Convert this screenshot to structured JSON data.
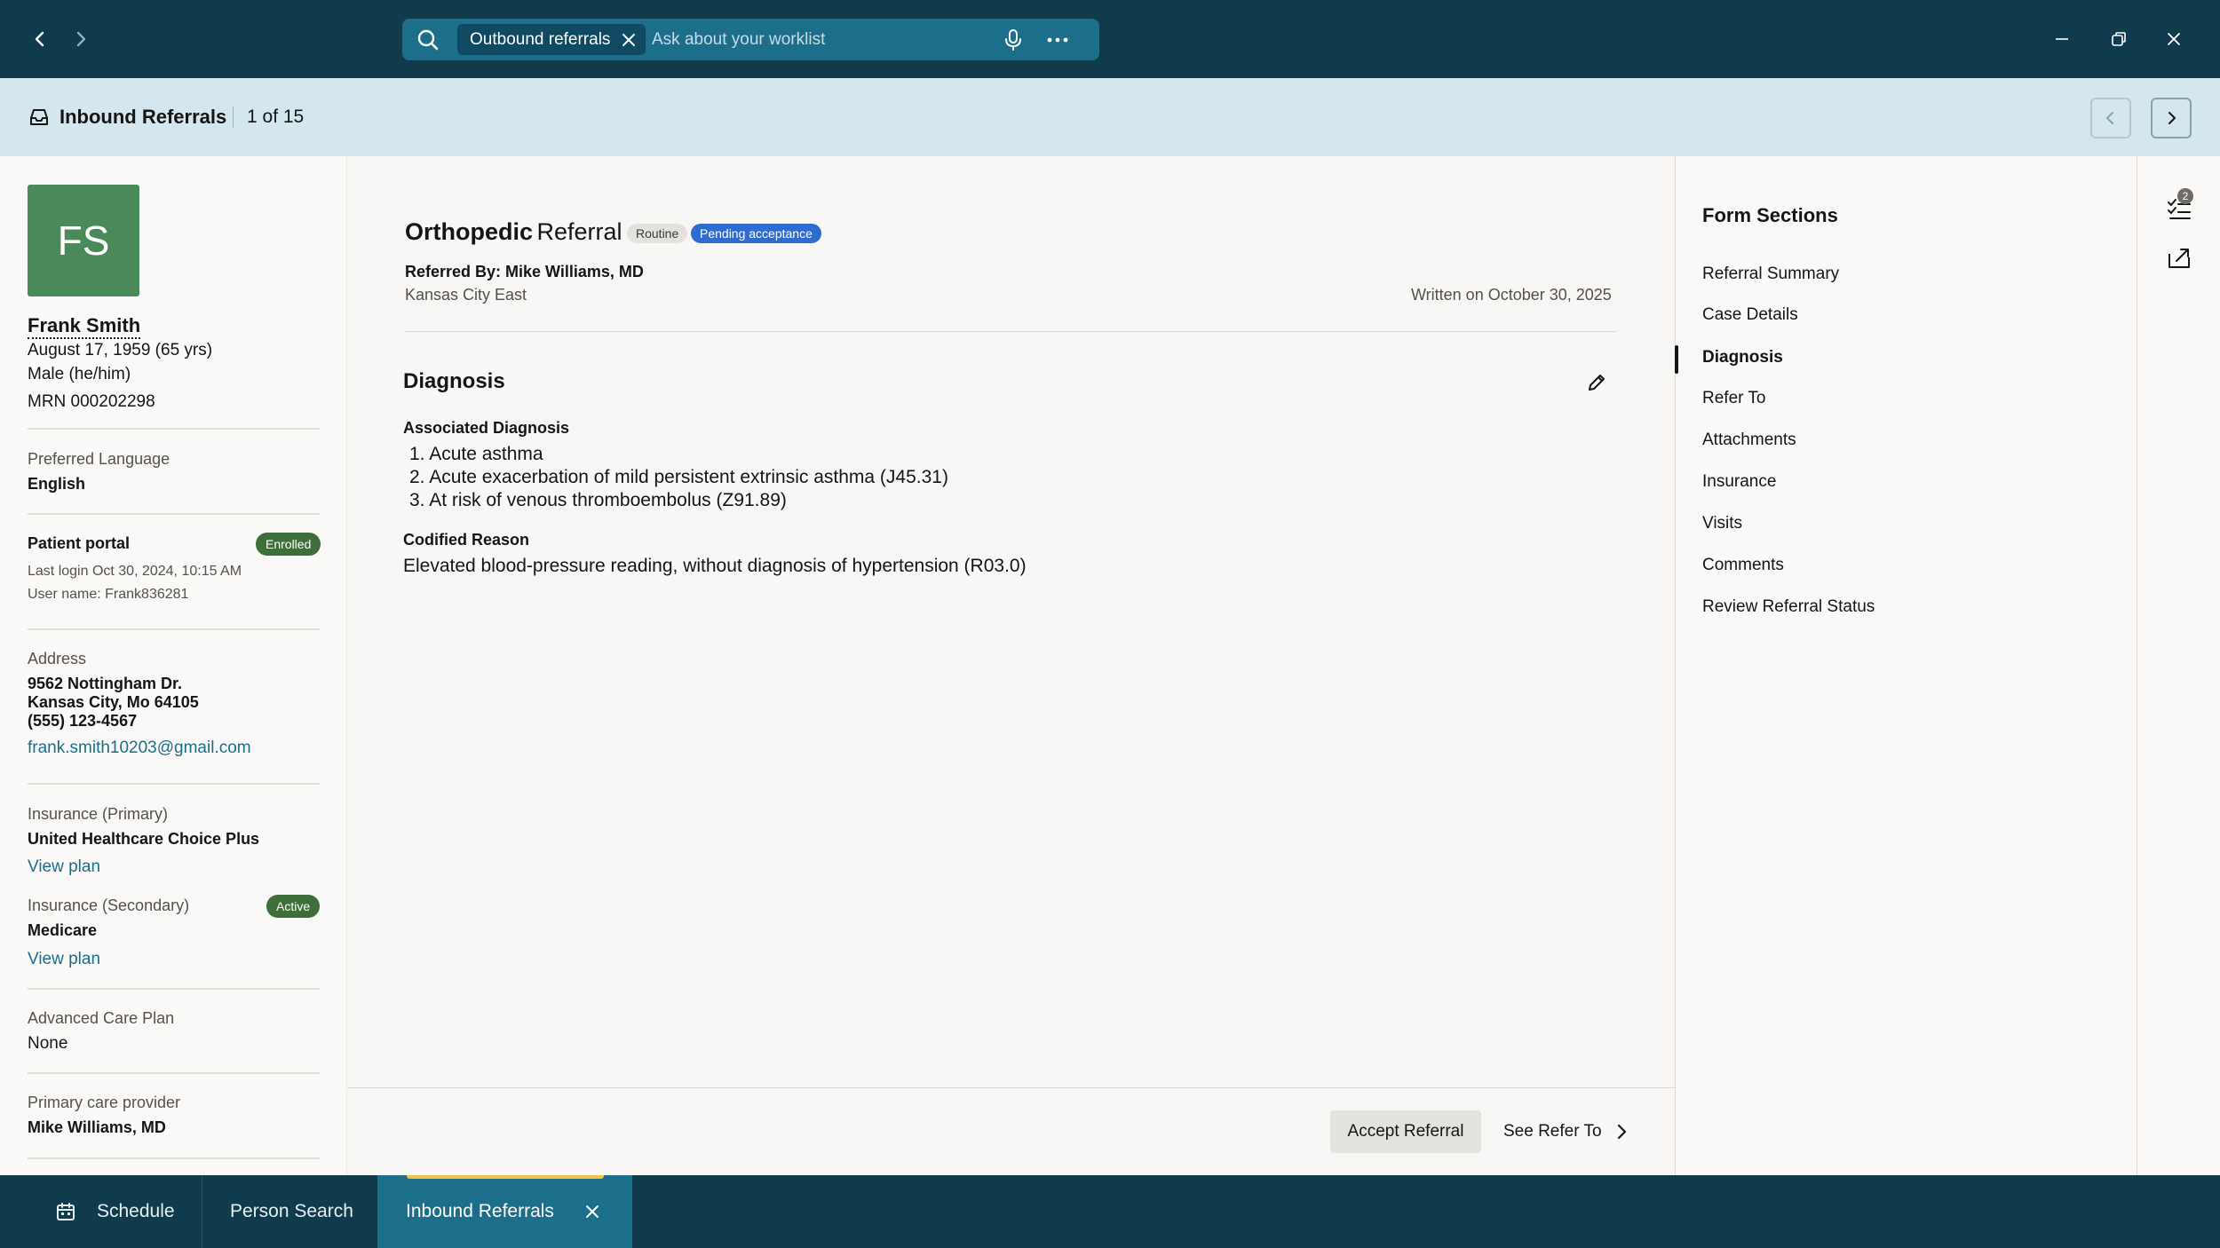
{
  "titlebar": {
    "search_chip": "Outbound referrals",
    "search_placeholder": "Ask about your worklist"
  },
  "header": {
    "title": "Inbound Referrals",
    "count": "1 of 15"
  },
  "patient": {
    "initials": "FS",
    "name": "Frank Smith",
    "dob": "August 17, 1959 (65 yrs)",
    "sex": "Male (he/him)",
    "mrn": "MRN 000202298",
    "language_label": "Preferred Language",
    "language": "English",
    "portal_label": "Patient portal",
    "portal_status": "Enrolled",
    "last_login": "Last login Oct 30, 2024, 10:15 AM",
    "username": "User name: Frank836281",
    "address_label": "Address",
    "address_line1": "9562 Nottingham Dr.",
    "address_line2": "Kansas City, Mo 64105",
    "phone": "(555) 123-4567",
    "email": "frank.smith10203@gmail.com",
    "ins_primary_label": "Insurance (Primary)",
    "ins_primary": "United Healthcare Choice Plus",
    "view_plan_1": "View plan",
    "ins_secondary_label": "Insurance (Secondary)",
    "ins_secondary_status": "Active",
    "ins_secondary": "Medicare",
    "view_plan_2": "View plan",
    "acp_label": "Advanced Care Plan",
    "acp": "None",
    "pcp_label": "Primary care provider",
    "pcp": "Mike Williams, MD"
  },
  "referral": {
    "title_bold": "Orthopedic",
    "title_rest": "Referral",
    "tag_priority": "Routine",
    "tag_status": "Pending acceptance",
    "referred_by": "Referred By: Mike Williams, MD",
    "location": "Kansas City East",
    "written_on": "Written on October 30, 2025",
    "section_title": "Diagnosis",
    "assoc_label": "Associated Diagnosis",
    "diagnoses": [
      "1.  Acute asthma",
      "2.  Acute exacerbation of mild persistent extrinsic asthma (J45.31)",
      "3.  At risk of venous thromboembolus (Z91.89)"
    ],
    "codified_label": "Codified Reason",
    "codified_reason": "Elevated blood-pressure reading, without diagnosis of hypertension (R03.0)",
    "accept_button": "Accept Referral",
    "see_refer_button": "See Refer To"
  },
  "form_sections": {
    "title": "Form Sections",
    "items": [
      "Referral Summary",
      "Case Details",
      "Diagnosis",
      "Refer To",
      "Attachments",
      "Insurance",
      "Visits",
      "Comments",
      "Review Referral Status"
    ],
    "active": "Diagnosis"
  },
  "toolstrip": {
    "task_badge": "2"
  },
  "taskbar": {
    "tabs": [
      "Schedule",
      "Person Search",
      "Inbound Referrals"
    ]
  },
  "colors": {
    "titlebar_bg": "#0f3b4c",
    "header_bg": "#d4e6ee",
    "avatar_bg": "#4a8a5a",
    "pending_tag": "#2f6bd0",
    "enrolled_badge": "#3e6e3a",
    "link": "#1b6f8c"
  }
}
